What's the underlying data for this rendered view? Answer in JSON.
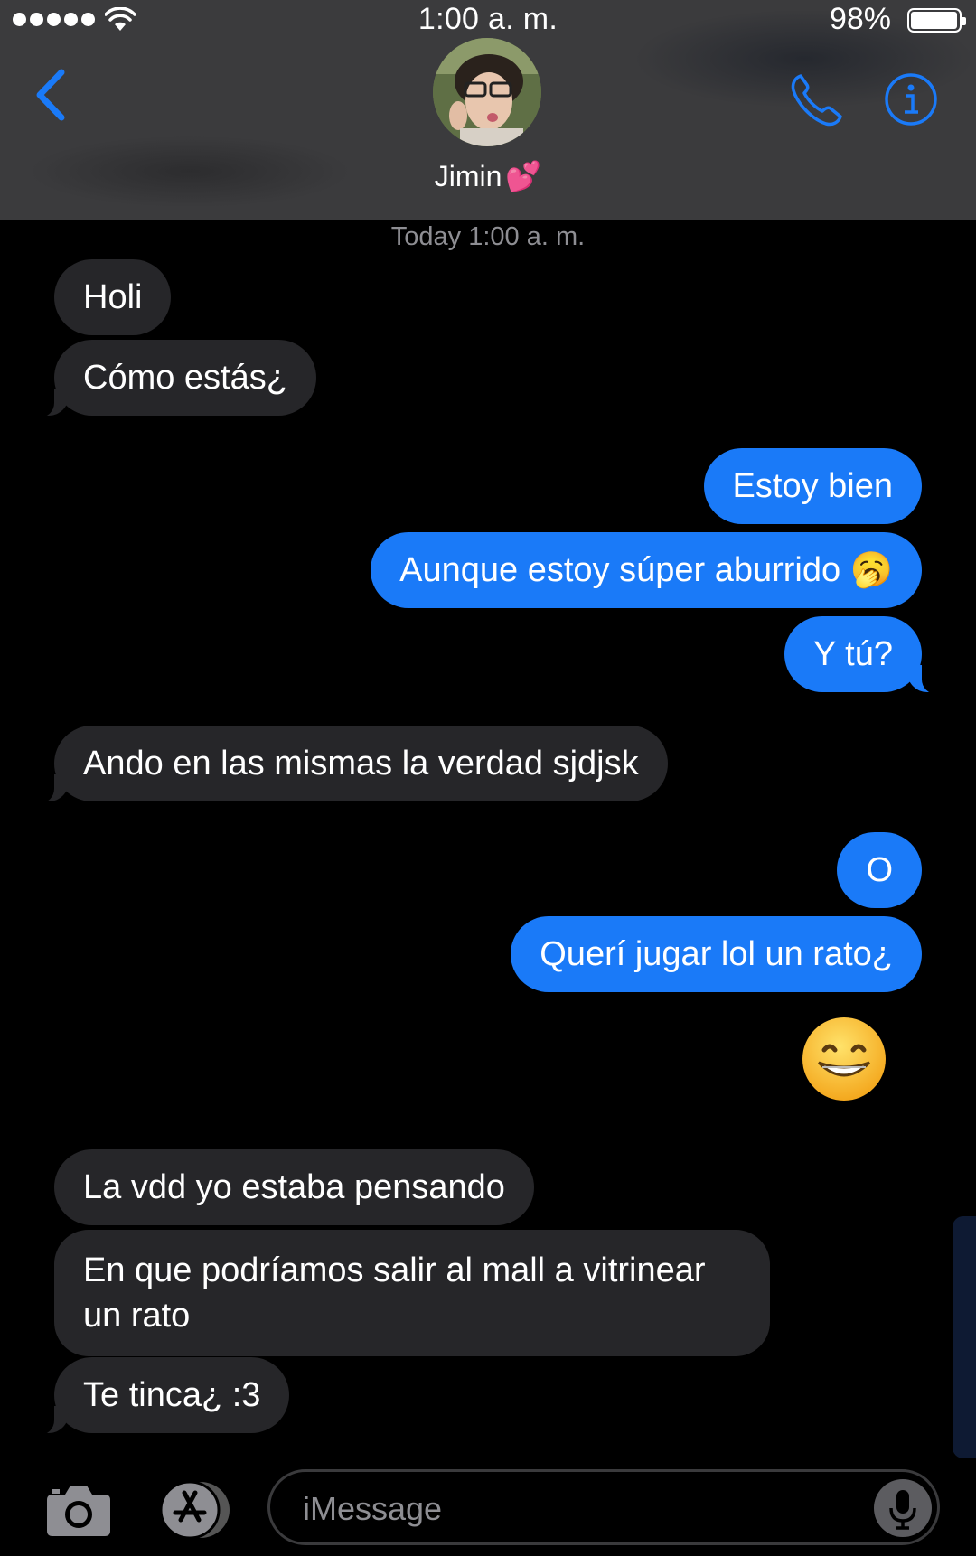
{
  "status_bar": {
    "time": "1:00 a. m.",
    "battery_percent": "98%",
    "battery_level": 0.98,
    "signal_bars": 5
  },
  "header": {
    "contact_name": "Jimin",
    "contact_emoji": "💕",
    "back_icon": "chevron-left-icon",
    "call_icon": "phone-icon",
    "info_icon": "info-icon",
    "accent_color": "#1a7af8"
  },
  "conversation": {
    "timestamp": "Today 1:00 a. m.",
    "messages": [
      {
        "from": "contact",
        "text": "Holi"
      },
      {
        "from": "contact",
        "text": "Cómo estás¿"
      },
      {
        "from": "me",
        "text": "Estoy bien"
      },
      {
        "from": "me",
        "text": "Aunque estoy súper aburrido 🥱"
      },
      {
        "from": "me",
        "text": "Y tú?"
      },
      {
        "from": "contact",
        "text": "Ando en las mismas la verdad sjdjsk"
      },
      {
        "from": "me",
        "text": "O"
      },
      {
        "from": "me",
        "text": "Querí jugar lol un rato¿"
      },
      {
        "from": "me",
        "text": "😁"
      },
      {
        "from": "contact",
        "text": "La vdd yo estaba pensando"
      },
      {
        "from": "contact",
        "text": "En que podríamos salir al mall a vitrinear un rato"
      },
      {
        "from": "contact",
        "text": "Te tinca¿ :3"
      }
    ]
  },
  "composer": {
    "placeholder": "iMessage",
    "camera_icon": "camera-icon",
    "apps_icon": "app-store-icon",
    "mic_icon": "microphone-icon"
  }
}
